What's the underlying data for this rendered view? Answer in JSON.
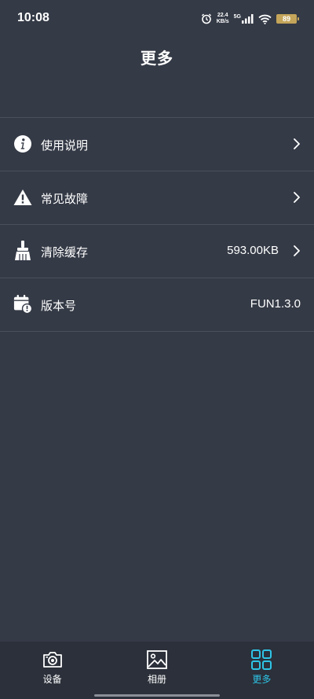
{
  "status_bar": {
    "time": "10:08",
    "net_speed_value": "22.4",
    "net_speed_unit": "KB/s",
    "signal_label": "5G",
    "battery": "89",
    "battery_color": "#c4a55a"
  },
  "header": {
    "title": "更多"
  },
  "menu": {
    "items": [
      {
        "label": "使用说明",
        "icon": "info-icon",
        "value": "",
        "has_arrow": true
      },
      {
        "label": "常见故障",
        "icon": "warning-icon",
        "value": "",
        "has_arrow": true
      },
      {
        "label": "清除缓存",
        "icon": "broom-icon",
        "value": "593.00KB",
        "has_arrow": true
      },
      {
        "label": "版本号",
        "icon": "calendar-alert-icon",
        "value": "FUN1.3.0",
        "has_arrow": false
      }
    ]
  },
  "tab_bar": {
    "tabs": [
      {
        "label": "设备",
        "icon": "camera-icon",
        "active": false
      },
      {
        "label": "相册",
        "icon": "image-icon",
        "active": false
      },
      {
        "label": "更多",
        "icon": "grid-icon",
        "active": true
      }
    ],
    "active_color": "#2ec4e6"
  },
  "colors": {
    "background": "#343a46",
    "tab_bar_background": "#2b303a",
    "divider": "#4a505c"
  }
}
